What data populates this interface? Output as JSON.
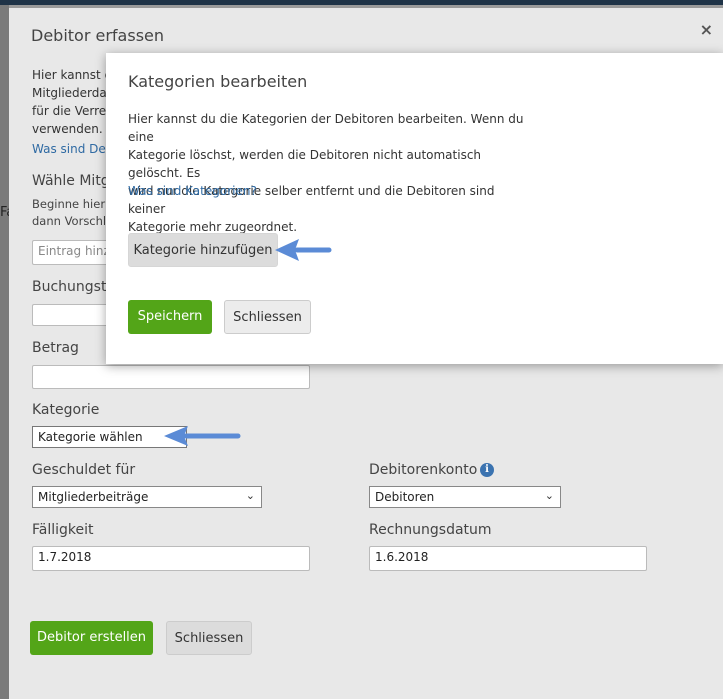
{
  "background_form": {
    "title": "Debitor erfassen",
    "close_glyph": "×",
    "intro_lines": [
      "Hier kannst du",
      "Mitgliederdat",
      "für die Verrec",
      "verwenden."
    ],
    "intro_link": "Was sind Deb",
    "choose_label": "Wähle Mitg",
    "choose_help_lines": [
      "Beginne hier e",
      "dann Vorschlä"
    ],
    "entry_placeholder": "Eintrag hinz",
    "buchungstext_label": "Buchungste",
    "betrag_label": "Betrag",
    "kategorie_label": "Kategorie",
    "kategorie_value": "Kategorie wählen",
    "geschuldet_label": "Geschuldet für",
    "geschuldet_value": "Mitgliederbeiträge",
    "debitorenkonto_label": "Debitorenkonto",
    "debitorenkonto_value": "Debitoren",
    "faelligkeit_label": "Fälligkeit",
    "faelligkeit_value": "1.7.2018",
    "rechnungsdatum_label": "Rechnungsdatum",
    "rechnungsdatum_value": "1.6.2018",
    "create_button": "Debitor erstellen",
    "close_button": "Schliessen",
    "chevron_glyph": "⌄",
    "info_glyph": "i"
  },
  "side_letter": "Fa",
  "dialog": {
    "title": "Kategorien bearbeiten",
    "text_lines": [
      "Hier kannst du die Kategorien der Debitoren bearbeiten. Wenn du eine",
      "Kategorie löschst, werden die Debitoren nicht automatisch gelöscht. Es",
      "wird nur die Kategorie selber entfernt und die Debitoren sind keiner",
      "Kategorie mehr zugeordnet."
    ],
    "link": "Was sind Kategorien?",
    "add_button": "Kategorie hinzufügen",
    "save_button": "Speichern",
    "close_button": "Schliessen"
  },
  "colors": {
    "accent_green": "#53a518",
    "link_blue": "#2f6aa3",
    "arrow_blue": "#5b8bd6"
  }
}
